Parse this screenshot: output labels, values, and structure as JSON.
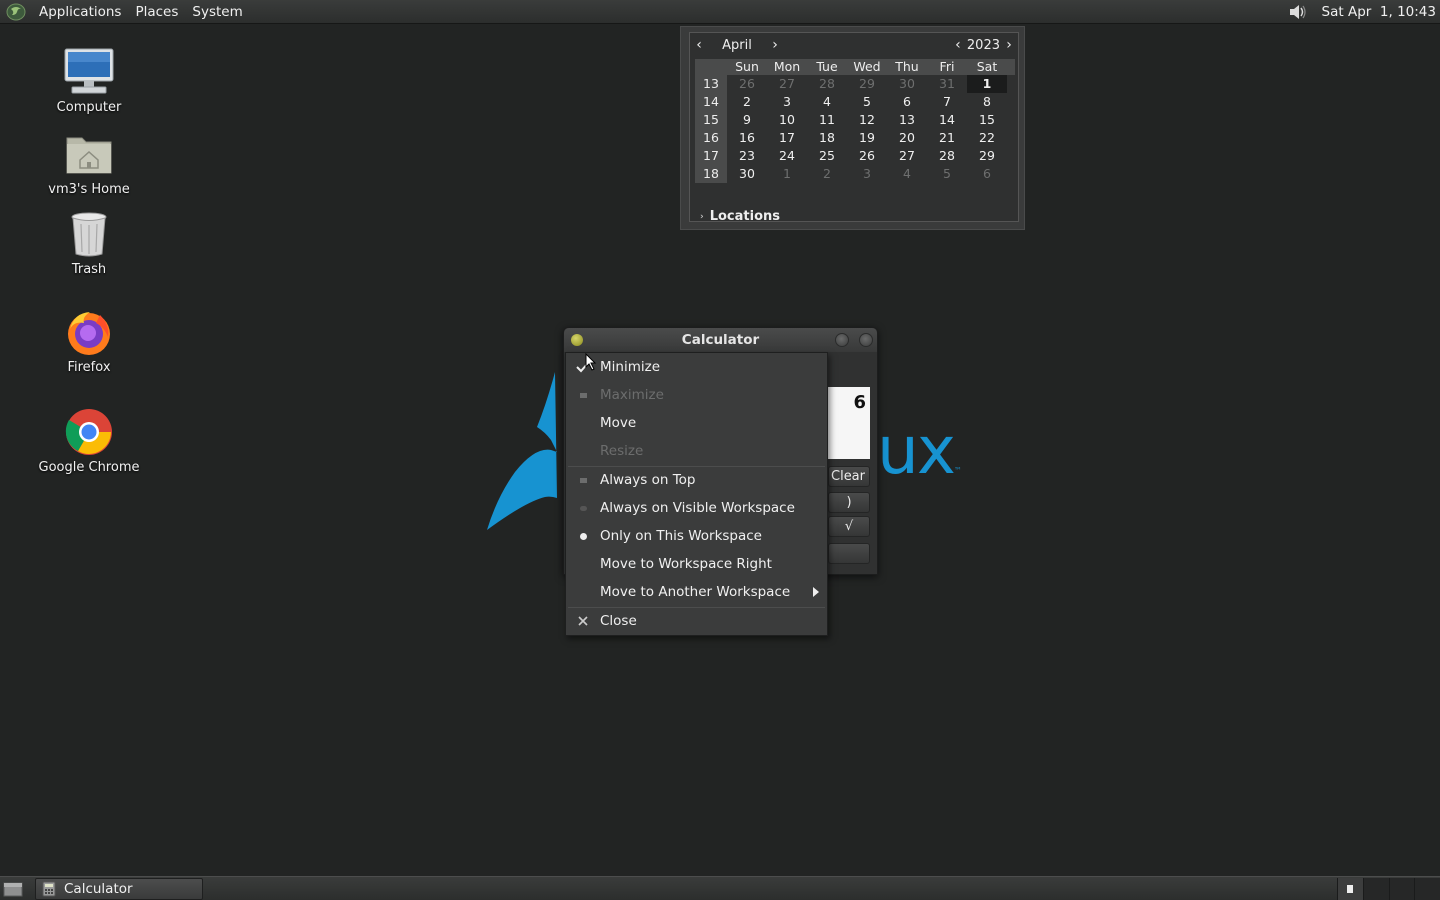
{
  "top_panel": {
    "menus": [
      "Applications",
      "Places",
      "System"
    ],
    "clock": "Sat Apr  1, 10:43"
  },
  "desktop_icons": [
    {
      "label": "Computer"
    },
    {
      "label": "vm3's Home"
    },
    {
      "label": "Trash"
    },
    {
      "label": "Firefox"
    },
    {
      "label": "Google Chrome"
    }
  ],
  "calendar": {
    "month": "April",
    "year": "2023",
    "weekday_headers": [
      "Sun",
      "Mon",
      "Tue",
      "Wed",
      "Thu",
      "Fri",
      "Sat"
    ],
    "weeks": [
      {
        "week": "13",
        "days": [
          "26",
          "27",
          "28",
          "29",
          "30",
          "31",
          "1"
        ]
      },
      {
        "week": "14",
        "days": [
          "2",
          "3",
          "4",
          "5",
          "6",
          "7",
          "8"
        ]
      },
      {
        "week": "15",
        "days": [
          "9",
          "10",
          "11",
          "12",
          "13",
          "14",
          "15"
        ]
      },
      {
        "week": "16",
        "days": [
          "16",
          "17",
          "18",
          "19",
          "20",
          "21",
          "22"
        ]
      },
      {
        "week": "17",
        "days": [
          "23",
          "24",
          "25",
          "26",
          "27",
          "28",
          "29"
        ]
      },
      {
        "week": "18",
        "days": [
          "30",
          "1",
          "2",
          "3",
          "4",
          "5",
          "6"
        ]
      }
    ],
    "selected_day": "1",
    "locations_label": "Locations"
  },
  "calculator_window": {
    "title": "Calculator",
    "display_value": "6",
    "keys": [
      "Clear",
      ")",
      "√",
      ""
    ]
  },
  "window_menu": {
    "items": [
      {
        "label": "Minimize",
        "enabled": true
      },
      {
        "label": "Maximize",
        "enabled": false
      },
      {
        "label": "Move",
        "enabled": true
      },
      {
        "label": "Resize",
        "enabled": false
      },
      {
        "label": "Always on Top",
        "enabled": true
      },
      {
        "label": "Always on Visible Workspace",
        "enabled": true
      },
      {
        "label": "Only on This Workspace",
        "enabled": true,
        "selected": true
      },
      {
        "label": "Move to Workspace Right",
        "enabled": true
      },
      {
        "label": "Move to Another Workspace",
        "enabled": true,
        "submenu": true
      },
      {
        "label": "Close",
        "enabled": true
      }
    ]
  },
  "wallpaper": {
    "logo_text": "ux",
    "trademark": "™",
    "brand_color": "#1793d1"
  },
  "bottom_panel": {
    "tasks": [
      "Calculator"
    ]
  }
}
